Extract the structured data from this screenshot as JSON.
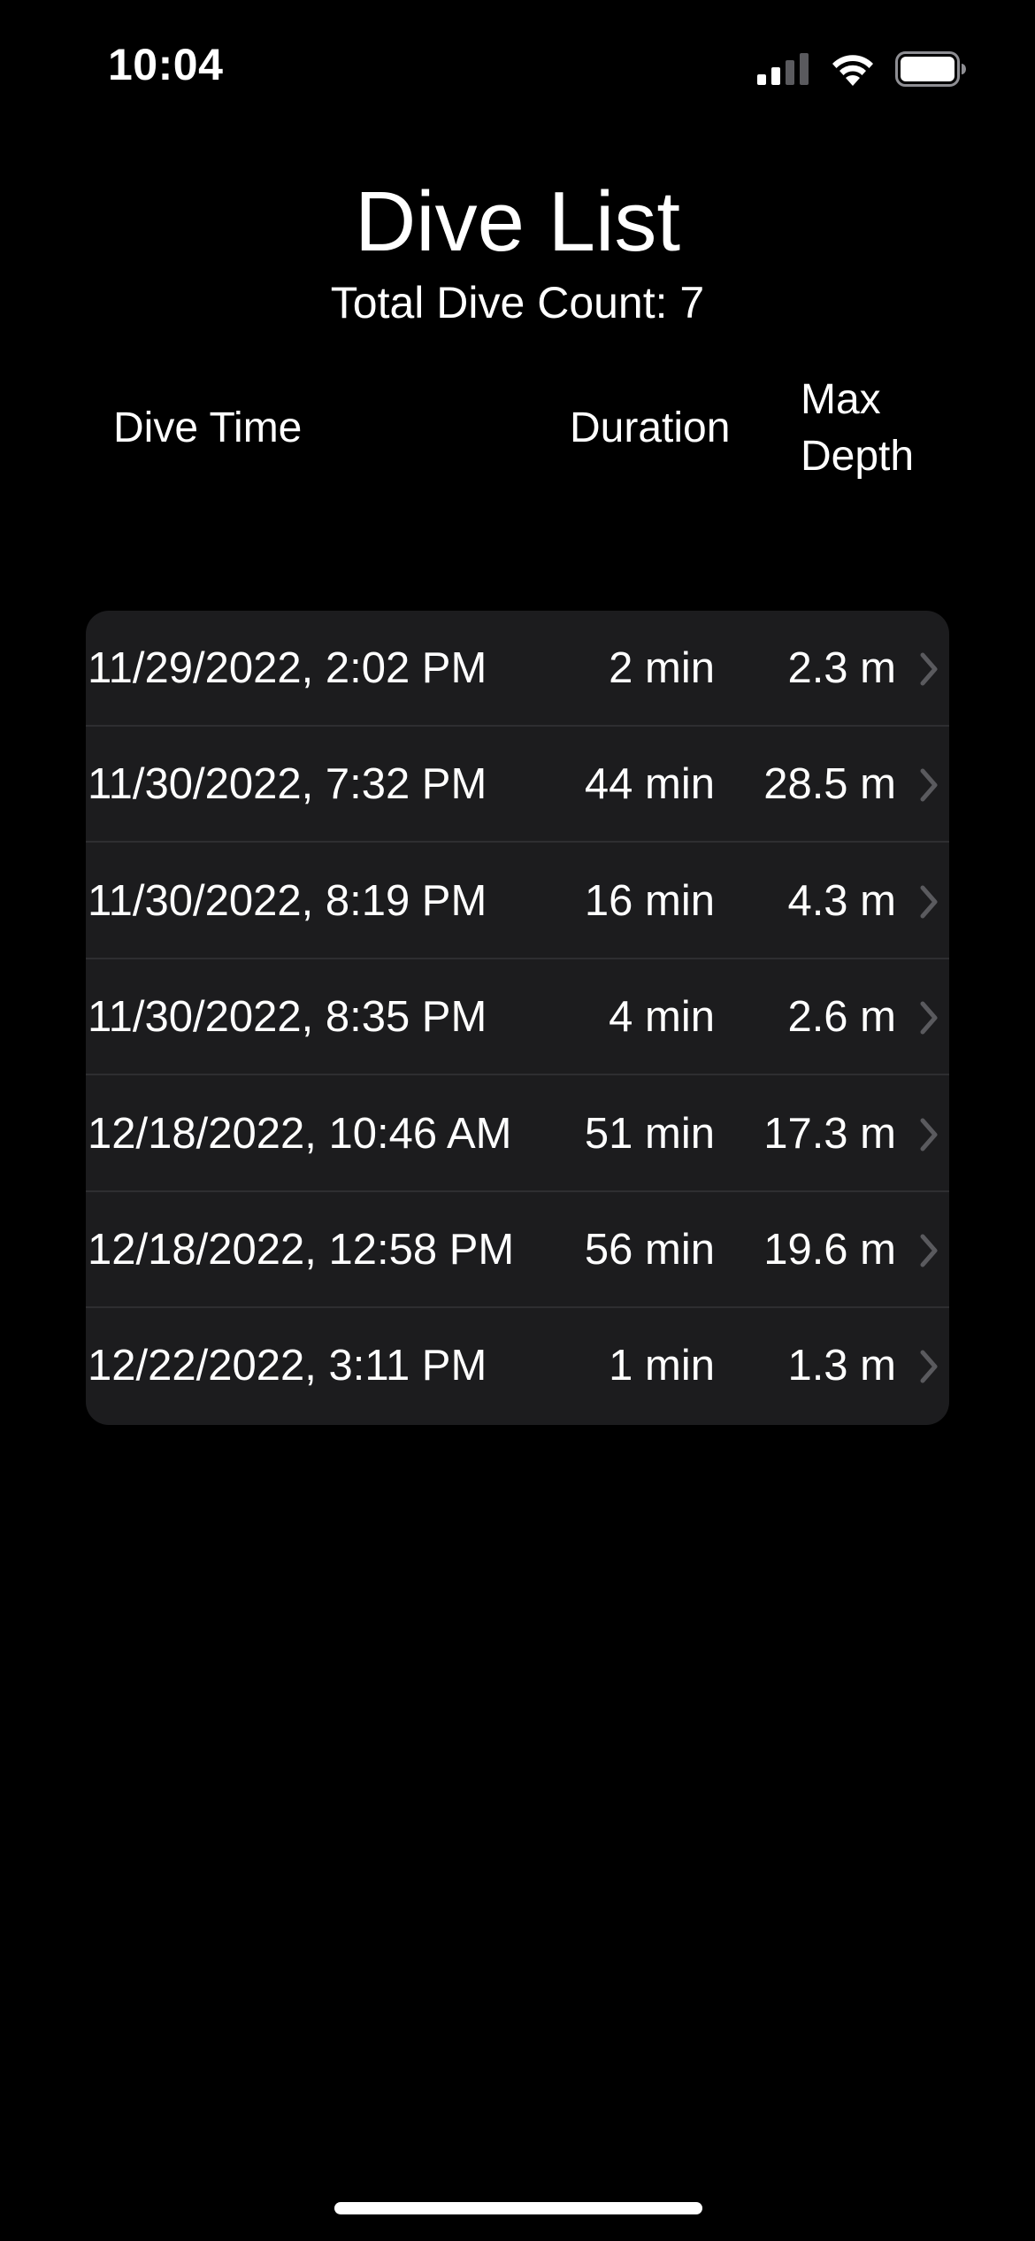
{
  "status_bar": {
    "time": "10:04",
    "icons": [
      "cellular-signal-icon",
      "wifi-icon",
      "battery-icon"
    ]
  },
  "header": {
    "title": "Dive List",
    "subtitle": "Total Dive Count: 7"
  },
  "columns": {
    "dive_time": "Dive Time",
    "duration": "Duration",
    "max_depth": "Max\nDepth"
  },
  "dives": [
    {
      "time": "11/29/2022, 2:02 PM",
      "duration": "2 min",
      "depth": "2.3 m"
    },
    {
      "time": "11/30/2022, 7:32 PM",
      "duration": "44 min",
      "depth": "28.5 m"
    },
    {
      "time": "11/30/2022, 8:19 PM",
      "duration": "16 min",
      "depth": "4.3 m"
    },
    {
      "time": "11/30/2022, 8:35 PM",
      "duration": "4 min",
      "depth": "2.6 m"
    },
    {
      "time": "12/18/2022, 10:46 AM",
      "duration": "51 min",
      "depth": "17.3 m"
    },
    {
      "time": "12/18/2022, 12:58 PM",
      "duration": "56 min",
      "depth": "19.6 m"
    },
    {
      "time": "12/22/2022, 3:11 PM",
      "duration": "1 min",
      "depth": "1.3 m"
    }
  ],
  "colors": {
    "background": "#000000",
    "card": "#1c1c1e",
    "divider": "#2e2e31",
    "chevron": "#5a5a5e",
    "text": "#ffffff"
  }
}
